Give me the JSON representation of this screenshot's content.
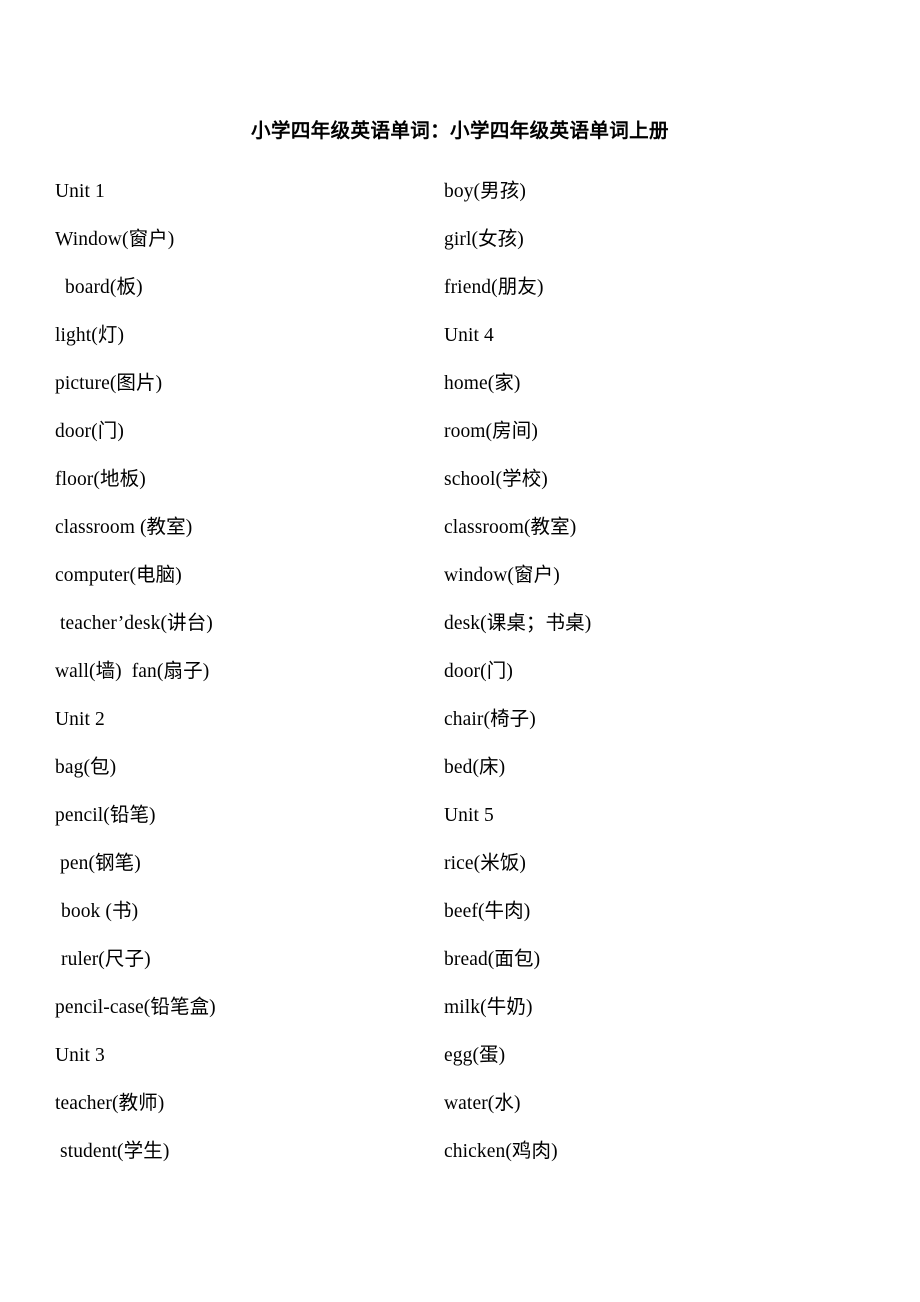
{
  "document": {
    "title": "小学四年级英语单词：小学四年级英语单词上册",
    "background_color": "#ffffff",
    "text_color": "#000000"
  },
  "columns": {
    "left": [
      {
        "text": "Unit 1",
        "indent": 0
      },
      {
        "text": "Window(窗户)",
        "indent": 0
      },
      {
        "text": "board(板)",
        "indent": 10
      },
      {
        "text": "light(灯)",
        "indent": 0
      },
      {
        "text": "picture(图片)",
        "indent": 0
      },
      {
        "text": "door(门)",
        "indent": 0
      },
      {
        "text": "floor(地板)",
        "indent": 0
      },
      {
        "text": "classroom (教室)",
        "indent": 0
      },
      {
        "text": "computer(电脑)",
        "indent": 0
      },
      {
        "text": "teacher’desk(讲台)",
        "indent": 5
      },
      {
        "text": "wall(墙)  fan(扇子)",
        "indent": 0
      },
      {
        "text": "Unit 2",
        "indent": 0
      },
      {
        "text": "bag(包)",
        "indent": 0
      },
      {
        "text": "pencil(铅笔)",
        "indent": 0
      },
      {
        "text": "pen(钢笔)",
        "indent": 5
      },
      {
        "text": "book (书)",
        "indent": 6
      },
      {
        "text": "ruler(尺子)",
        "indent": 6
      },
      {
        "text": "pencil-case(铅笔盒)",
        "indent": 0
      },
      {
        "text": "Unit 3",
        "indent": 0
      },
      {
        "text": "teacher(教师)",
        "indent": 0
      },
      {
        "text": "student(学生)",
        "indent": 5
      }
    ],
    "right": [
      {
        "text": "boy(男孩)",
        "indent": 0
      },
      {
        "text": "girl(女孩)",
        "indent": 0
      },
      {
        "text": "friend(朋友)",
        "indent": 0
      },
      {
        "text": "Unit 4",
        "indent": 0
      },
      {
        "text": "home(家)",
        "indent": 0
      },
      {
        "text": "room(房间)",
        "indent": 0
      },
      {
        "text": "school(学校)",
        "indent": 0
      },
      {
        "text": "classroom(教室)",
        "indent": 0
      },
      {
        "text": "window(窗户)",
        "indent": 0
      },
      {
        "text": "desk(课桌；书桌)",
        "indent": 0
      },
      {
        "text": "door(门)",
        "indent": 0
      },
      {
        "text": "chair(椅子)",
        "indent": 0
      },
      {
        "text": "bed(床)",
        "indent": 0
      },
      {
        "text": "Unit 5",
        "indent": 0
      },
      {
        "text": "rice(米饭)",
        "indent": 0
      },
      {
        "text": "beef(牛肉)",
        "indent": 0
      },
      {
        "text": "bread(面包)",
        "indent": 0
      },
      {
        "text": "milk(牛奶)",
        "indent": 0
      },
      {
        "text": "egg(蛋)",
        "indent": 0
      },
      {
        "text": "water(水)",
        "indent": 0
      },
      {
        "text": "chicken(鸡肉)",
        "indent": 0
      }
    ]
  }
}
